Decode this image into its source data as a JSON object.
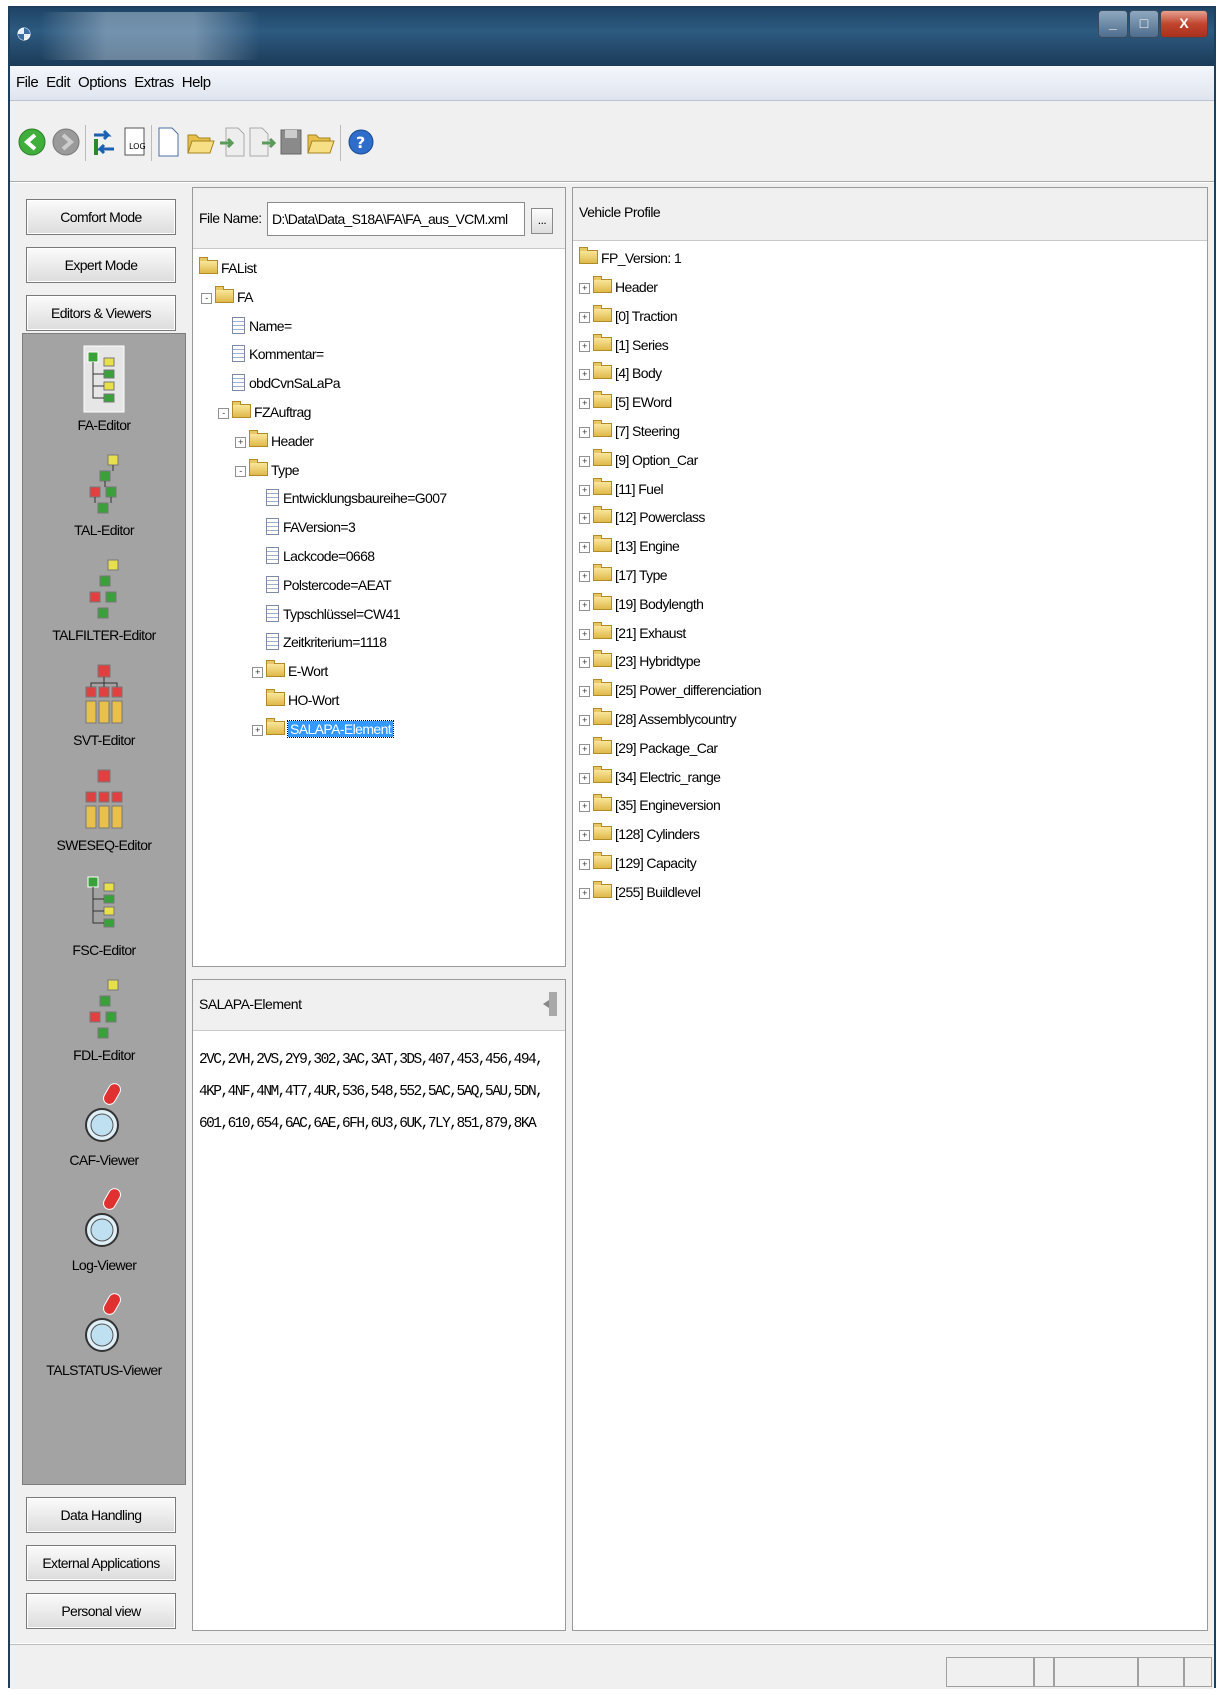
{
  "window": {
    "buttons": [
      "_",
      "□",
      "X"
    ]
  },
  "menu": [
    "File",
    "Edit",
    "Options",
    "Extras",
    "Help"
  ],
  "toolbar": {
    "icons": [
      "back-icon",
      "forward-icon",
      "transfer-icon",
      "log-file-icon",
      "new-file-icon",
      "open-folder-icon",
      "import-icon",
      "export-icon",
      "save-icon",
      "open-folder-2-icon",
      "help-icon"
    ]
  },
  "sidebar": {
    "modes": [
      "Comfort Mode",
      "Expert Mode",
      "Editors & Viewers"
    ],
    "tools": [
      "FA-Editor",
      "TAL-Editor",
      "TALFILTER-Editor",
      "SVT-Editor",
      "SWESEQ-Editor",
      "FSC-Editor",
      "FDL-Editor",
      "CAF-Viewer",
      "Log-Viewer",
      "TALSTATUS-Viewer"
    ],
    "bottom": [
      "Data Handling",
      "External Applications",
      "Personal view"
    ]
  },
  "fa_panel": {
    "file_label": "File Name:",
    "file_value": "D:\\Data\\Data_S18A\\FA\\FA_aus_VCM.xml",
    "browse_label": "...",
    "tree": [
      {
        "label": "FAList",
        "type": "folder",
        "level": 0
      },
      {
        "label": "FA",
        "type": "folder",
        "level": 1,
        "exp": "-"
      },
      {
        "label": "Name=",
        "type": "doc",
        "level": 2
      },
      {
        "label": "Kommentar=",
        "type": "doc",
        "level": 2
      },
      {
        "label": "obdCvnSaLaPa",
        "type": "doc",
        "level": 2
      },
      {
        "label": "FZAuftrag",
        "type": "folder",
        "level": 2,
        "exp": "-"
      },
      {
        "label": "Header",
        "type": "folder",
        "level": 3,
        "exp": "+"
      },
      {
        "label": "Type",
        "type": "folder",
        "level": 3,
        "exp": "-"
      },
      {
        "label": "Entwicklungsbaureihe=G007",
        "type": "doc",
        "level": 4
      },
      {
        "label": "FAVersion=3",
        "type": "doc",
        "level": 4
      },
      {
        "label": "Lackcode=0668",
        "type": "doc",
        "level": 4
      },
      {
        "label": "Polstercode=AEAT",
        "type": "doc",
        "level": 4
      },
      {
        "label": "Typschlüssel=CW41",
        "type": "doc",
        "level": 4
      },
      {
        "label": "Zeitkriterium=1118",
        "type": "doc",
        "level": 4
      },
      {
        "label": "E-Wort",
        "type": "folder",
        "level": 4,
        "exp": "+"
      },
      {
        "label": "HO-Wort",
        "type": "folder",
        "level": 4
      },
      {
        "label": "SALAPA-Element",
        "type": "folder",
        "level": 4,
        "exp": "+",
        "selected": true
      }
    ]
  },
  "salapa_panel": {
    "title": "SALAPA-Element",
    "lines": [
      "2VC,2VH,2VS,2Y9,302,3AC,3AT,3DS,407,453,456,494,",
      "4KP,4NF,4NM,4T7,4UR,536,548,552,5AC,5AQ,5AU,5DN,",
      "601,610,654,6AC,6AE,6FH,6U3,6UK,7LY,851,879,8KA"
    ]
  },
  "vehicle_panel": {
    "title": "Vehicle Profile",
    "root": "FP_Version: 1",
    "items": [
      "Header",
      "[0] Traction",
      "[1] Series",
      "[4] Body",
      "[5] EWord",
      "[7] Steering",
      "[9] Option_Car",
      "[11] Fuel",
      "[12] Powerclass",
      "[13] Engine",
      "[17] Type",
      "[19] Bodylength",
      "[21] Exhaust",
      "[23] Hybridtype",
      "[25] Power_differenciation",
      "[28] Assemblycountry",
      "[29] Package_Car",
      "[34] Electric_range",
      "[35] Engineversion",
      "[128] Cylinders",
      "[129] Capacity",
      "[255] Buildlevel"
    ]
  }
}
